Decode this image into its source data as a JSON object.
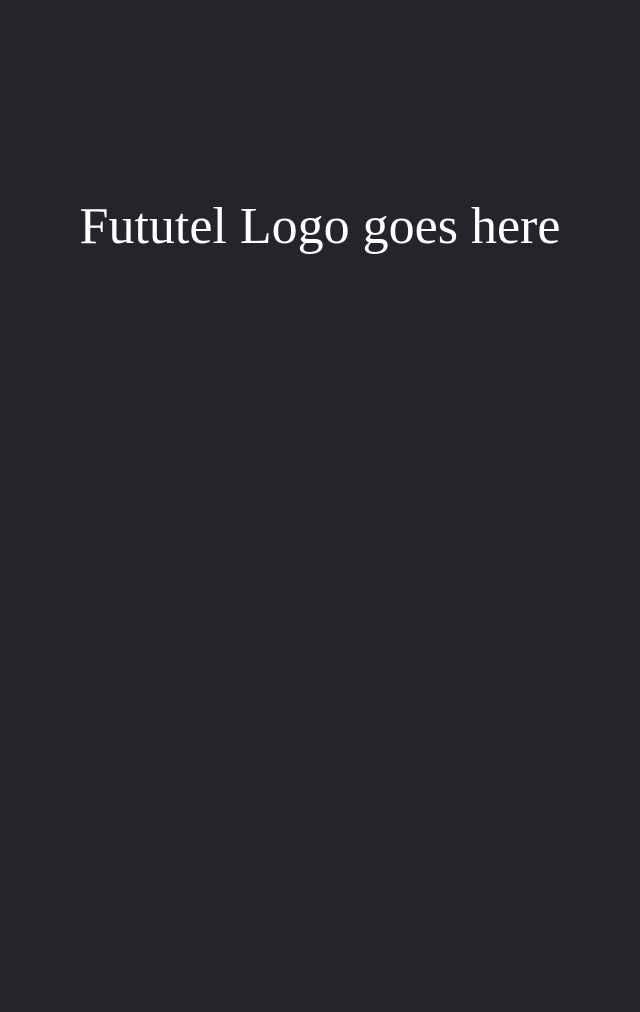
{
  "screen": {
    "logo_text": "Fututel Logo goes here",
    "background_color": "#25242a",
    "text_color": "#ffffff"
  }
}
